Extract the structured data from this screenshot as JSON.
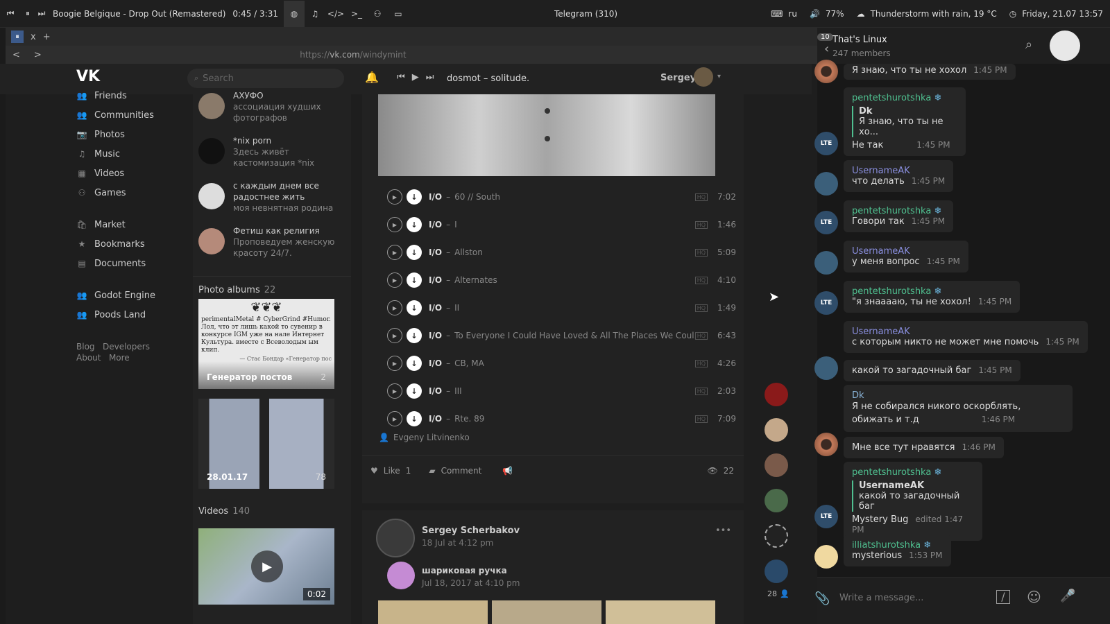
{
  "topbar": {
    "track": "Boogie Belgique - Drop Out (Remastered)",
    "time": "0:45 / 3:31",
    "window_title": "Telegram (310)",
    "lang": "ru",
    "volume": "77%",
    "weather": "Thunderstorm with rain, 19 °C",
    "datetime": "Friday, 21.07  13:57"
  },
  "browser": {
    "tab_close": "x",
    "tab_add": "+",
    "back": "<",
    "forward": ">",
    "url_prefix": "https://",
    "url_host": "vk.com",
    "url_path": "/windymint"
  },
  "vk": {
    "search_placeholder": "Search",
    "player": {
      "track": "dosmot – solitude.",
      "user": "Sergey"
    },
    "nav": [
      {
        "label": "Friends",
        "icon": "friends-icon"
      },
      {
        "label": "Communities",
        "icon": "communities-icon"
      },
      {
        "label": "Photos",
        "icon": "camera-icon"
      },
      {
        "label": "Music",
        "icon": "music-icon"
      },
      {
        "label": "Videos",
        "icon": "video-icon"
      },
      {
        "label": "Games",
        "icon": "gamepad-icon"
      }
    ],
    "nav2": [
      {
        "label": "Market",
        "icon": "bag-icon"
      },
      {
        "label": "Bookmarks",
        "icon": "star-icon"
      },
      {
        "label": "Documents",
        "icon": "document-icon"
      }
    ],
    "nav3": [
      {
        "label": "Godot Engine",
        "icon": "group-icon"
      },
      {
        "label": "Poods Land",
        "icon": "group-icon"
      }
    ],
    "footer": {
      "blog": "Blog",
      "developers": "Developers",
      "about": "About",
      "more": "More"
    },
    "groups": [
      {
        "name": "АХУФО",
        "desc": "ассоциация худших фотографов"
      },
      {
        "name": "*nix porn",
        "desc": "Здесь живёт кастомизация *nix"
      },
      {
        "name": "с каждым днем все радостнее жить",
        "desc": "моя невнятная родина"
      },
      {
        "name": "Фетиш как религия",
        "desc": "Проповедуем женскую красоту 24/7."
      }
    ],
    "albums": {
      "label": "Photo albums",
      "count": "22",
      "items": [
        {
          "title": "Генератор постов",
          "count": "2"
        },
        {
          "title": "28.01.17",
          "count": "78"
        }
      ]
    },
    "album_text": "perimentalMetal # CyberGrind #Humor. Лол, что эт лишь какой то сувенир в конкурсе IGM уже на нале Интернет Культура. вместе с Всеволодым ым клип.",
    "album_sig": "— Стас Бондар «Генератор пос",
    "videos": {
      "label": "Videos",
      "count": "140",
      "duration": "0:02"
    },
    "tracks": [
      {
        "artist": "I/O",
        "title": "60 // South",
        "dur": "7:02"
      },
      {
        "artist": "I/O",
        "title": "I",
        "dur": "1:46"
      },
      {
        "artist": "I/O",
        "title": "Allston",
        "dur": "5:09"
      },
      {
        "artist": "I/O",
        "title": "Alternates",
        "dur": "4:10"
      },
      {
        "artist": "I/O",
        "title": "II",
        "dur": "1:49"
      },
      {
        "artist": "I/O",
        "title": "To Everyone I Could Have Loved & All The Places We Coul...",
        "dur": "6:43"
      },
      {
        "artist": "I/O",
        "title": "CB, MA",
        "dur": "4:26"
      },
      {
        "artist": "I/O",
        "title": "III",
        "dur": "2:03"
      },
      {
        "artist": "I/O",
        "title": "Rte. 89",
        "dur": "7:09"
      }
    ],
    "hq": "HQ",
    "author": "Evgeny Litvinenko",
    "like": "Like",
    "likes": "1",
    "comment": "Comment",
    "views": "22",
    "post2": {
      "author": "Sergey Scherbakov",
      "date": "18 Jul at 4:12 pm",
      "repost_name": "шариковая ручка",
      "repost_date": "Jul 18, 2017 at 4:10 pm",
      "more": "•••"
    },
    "friends_online": "28"
  },
  "tg": {
    "title": "That's Linux",
    "members": "247 members",
    "badge": "10",
    "input_placeholder": "Write a message...",
    "m1": {
      "text": "Я знаю, что ты не хохол",
      "time": "1:45 PM"
    },
    "m2": {
      "name": "pentetshurotshka",
      "reply_name": "Dk",
      "reply_text": "Я знаю, что ты не хо...",
      "text": "Не так",
      "time": "1:45 PM"
    },
    "m3": {
      "name": "UsernameAK",
      "text": "что делать",
      "time": "1:45 PM"
    },
    "m4": {
      "name": "pentetshurotshka",
      "text": "Говори так",
      "time": "1:45 PM"
    },
    "m5": {
      "name": "UsernameAK",
      "text": "у меня вопрос",
      "time": "1:45 PM"
    },
    "m6": {
      "name": "pentetshurotshka",
      "text": "\"я знааааю, ты не хохол!",
      "time": "1:45 PM"
    },
    "m7": {
      "name": "UsernameAK",
      "text": "с которым никто не может мне помочь",
      "time": "1:45 PM"
    },
    "m8": {
      "text": "какой то загадочный баг",
      "time": "1:45 PM"
    },
    "m9": {
      "name": "Dk",
      "text": "Я не собирался никого оскорблять, обижать и т.д",
      "time": "1:46 PM"
    },
    "m10": {
      "text": "Мне все тут нравятся",
      "time": "1:46 PM"
    },
    "m11": {
      "name": "pentetshurotshka",
      "reply_name": "UsernameAK",
      "reply_text": "какой то загадочный баг",
      "text": "Mystery Bug",
      "time": "edited 1:47 PM"
    },
    "m12": {
      "name": "illiatshurotshka",
      "text": "mysterious",
      "time": "1:53 PM"
    },
    "snow": "❄"
  }
}
